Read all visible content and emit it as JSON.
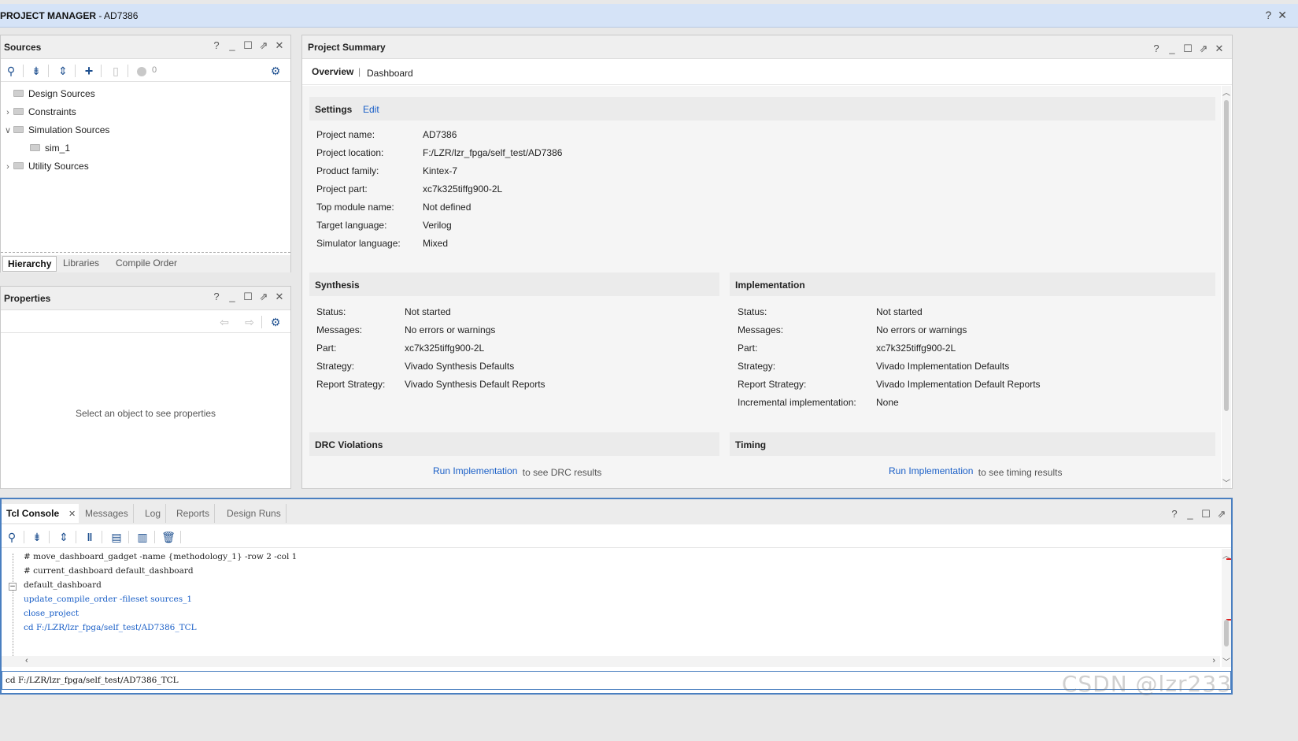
{
  "window": {
    "title_bold": "PROJECT MANAGER",
    "title_rest": " - AD7386",
    "help_icon": "?",
    "close_icon": "✕"
  },
  "sources": {
    "title": "Sources",
    "error_count": "0",
    "tree": [
      {
        "label": "Design Sources",
        "expanded": null,
        "indent": 0
      },
      {
        "label": "Constraints",
        "expanded": false,
        "indent": 0
      },
      {
        "label": "Simulation Sources",
        "expanded": true,
        "indent": 0
      },
      {
        "label": "sim_1",
        "expanded": null,
        "indent": 1
      },
      {
        "label": "Utility Sources",
        "expanded": false,
        "indent": 0
      }
    ],
    "tabs": [
      "Hierarchy",
      "Libraries",
      "Compile Order"
    ],
    "active_tab": "Hierarchy"
  },
  "properties": {
    "title": "Properties",
    "empty_text": "Select an object to see properties"
  },
  "summary": {
    "title": "Project Summary",
    "tabs": [
      "Overview",
      "Dashboard"
    ],
    "tab_separator": "|",
    "settings": {
      "heading": "Settings",
      "edit": "Edit",
      "rows": [
        {
          "k": "Project name:",
          "v": "AD7386",
          "link": false
        },
        {
          "k": "Project location:",
          "v": "F:/LZR/lzr_fpga/self_test/AD7386",
          "link": false
        },
        {
          "k": "Product family:",
          "v": "Kintex-7",
          "link": false
        },
        {
          "k": "Project part:",
          "v": "xc7k325tiffg900-2L",
          "link": true
        },
        {
          "k": "Top module name:",
          "v": "Not defined",
          "link": true
        },
        {
          "k": "Target language:",
          "v": "Verilog",
          "link": true
        },
        {
          "k": "Simulator language:",
          "v": "Mixed",
          "link": true
        }
      ]
    },
    "synthesis": {
      "heading": "Synthesis",
      "rows": [
        {
          "k": "Status:",
          "v": "Not started",
          "link": false
        },
        {
          "k": "Messages:",
          "v": "No errors or warnings",
          "link": false
        },
        {
          "k": "Part:",
          "v": "xc7k325tiffg900-2L",
          "link": false
        },
        {
          "k": "Strategy:",
          "v": "Vivado Synthesis Defaults",
          "link": true
        },
        {
          "k": "Report Strategy:",
          "v": "Vivado Synthesis Default Reports",
          "link": true
        }
      ]
    },
    "implementation": {
      "heading": "Implementation",
      "rows": [
        {
          "k": "Status:",
          "v": "Not started",
          "link": false
        },
        {
          "k": "Messages:",
          "v": "No errors or warnings",
          "link": false
        },
        {
          "k": "Part:",
          "v": "xc7k325tiffg900-2L",
          "link": false
        },
        {
          "k": "Strategy:",
          "v": "Vivado Implementation Defaults",
          "link": true
        },
        {
          "k": "Report Strategy:",
          "v": "Vivado Implementation Default Reports",
          "link": true
        },
        {
          "k": "Incremental implementation:",
          "v": "None",
          "link": true
        }
      ]
    },
    "drc": {
      "heading": "DRC Violations",
      "link": "Run Implementation",
      "suffix": "to see DRC results"
    },
    "timing": {
      "heading": "Timing",
      "link": "Run Implementation",
      "suffix": "to see timing results"
    }
  },
  "console": {
    "tabs": [
      "Tcl Console",
      "Messages",
      "Log",
      "Reports",
      "Design Runs"
    ],
    "active_tab": "Tcl Console",
    "lines": [
      {
        "text": "# move_dashboard_gadget -name {methodology_1} -row 2 -col 1",
        "blue": false
      },
      {
        "text": "# current_dashboard default_dashboard",
        "blue": false
      },
      {
        "text": "default_dashboard",
        "blue": false
      },
      {
        "text": "update_compile_order -fileset sources_1",
        "blue": true
      },
      {
        "text": "close_project",
        "blue": true
      },
      {
        "text": "cd F:/LZR/lzr_fpga/self_test/AD7386_TCL",
        "blue": true
      }
    ],
    "input_value": "cd F:/LZR/lzr_fpga/self_test/AD7386_TCL"
  },
  "watermark": "CSDN @lzr233"
}
